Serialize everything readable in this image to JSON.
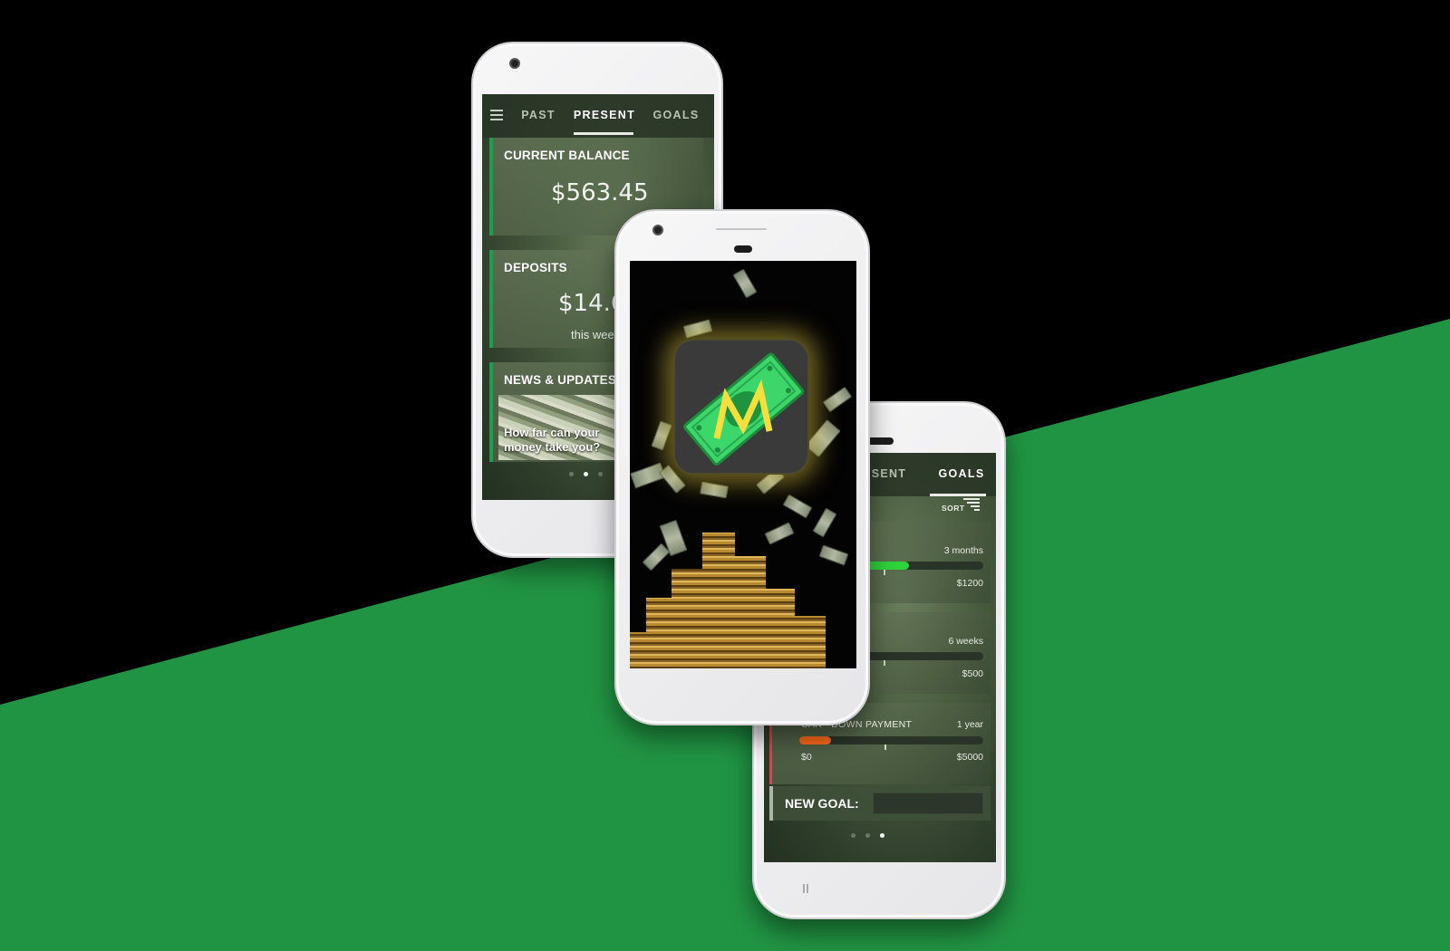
{
  "colors": {
    "background_black": "#000000",
    "background_green": "#219443",
    "accent_green": "#1e9e4a",
    "accent_red": "#d14b4b",
    "progress_orange": "#ff6a1a",
    "progress_green": "#2fd23c"
  },
  "left_phone": {
    "menu_icon": "hamburger-menu-icon",
    "tabs": [
      {
        "label": "PAST"
      },
      {
        "label": "PRESENT",
        "active": true
      },
      {
        "label": "GOALS"
      }
    ],
    "current_balance": {
      "title": "CURRENT BALANCE",
      "value": "$563.45"
    },
    "deposits": {
      "title": "DEPOSITS",
      "value": "$14.6",
      "subtitle": "this wee"
    },
    "news": {
      "title": "NEWS & UPDATES",
      "caption_line1": "How far can your",
      "caption_line2": "money take you?"
    },
    "page_dots": {
      "count": 3,
      "active": 1
    }
  },
  "center_phone": {
    "screen": "splash",
    "logo_icon": "money-bill-logo-icon",
    "logo_letter": "M"
  },
  "right_phone": {
    "tabs": [
      {
        "label": "RESENT"
      },
      {
        "label": "GOALS",
        "active": true
      }
    ],
    "sort_label": "SORT",
    "sort_icon": "sort-icon",
    "goals": [
      {
        "name": "",
        "time": "3 months",
        "max": "$1200",
        "progress": 0.6,
        "color": "#2fd23c"
      },
      {
        "name": "",
        "time": "6 weeks",
        "max": "$500",
        "progress": 0.0,
        "color": "#2fd23c"
      },
      {
        "name": "CAR - DOWN PAYMENT",
        "time": "1 year",
        "min": "$0",
        "max": "$5000",
        "progress": 0.17,
        "color": "#ff6a1a"
      }
    ],
    "new_goal_label": "NEW GOAL:",
    "page_dots": {
      "count": 3,
      "active": 2
    }
  }
}
